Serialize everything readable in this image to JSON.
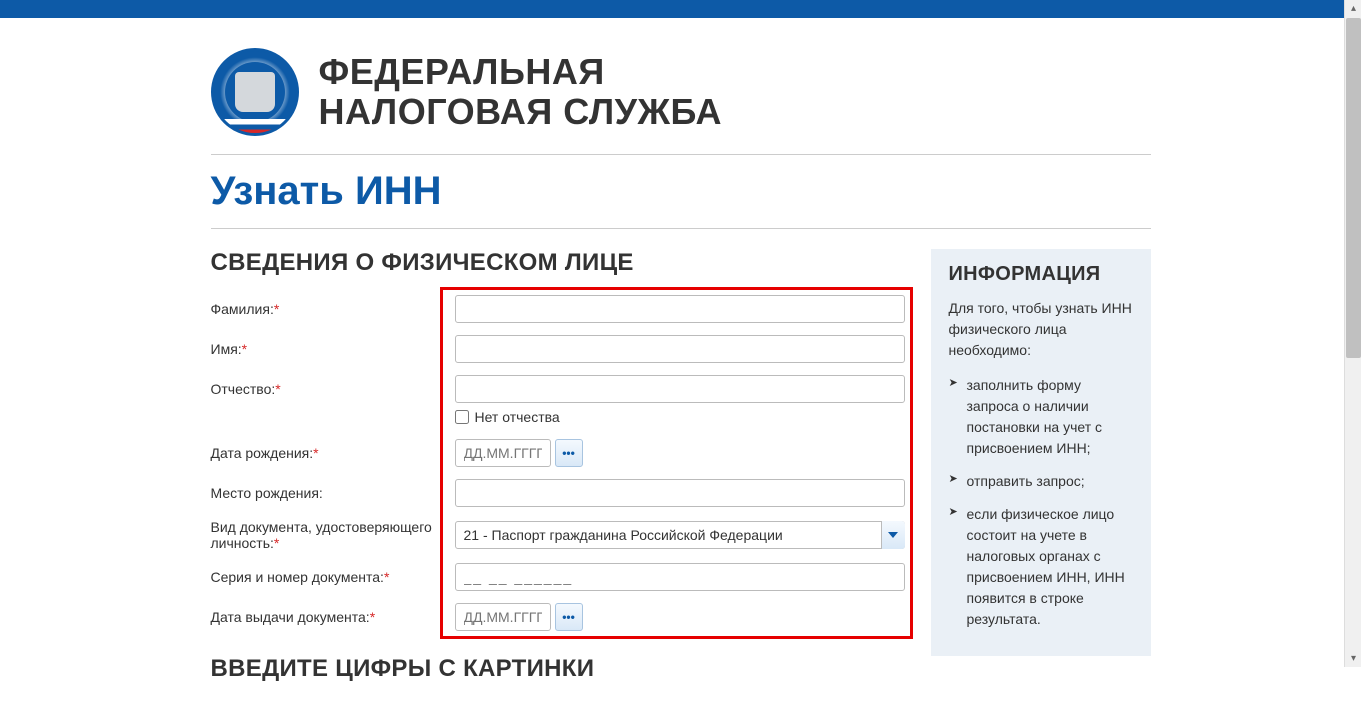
{
  "header": {
    "org_line1": "ФЕДЕРАЛЬНАЯ",
    "org_line2": "НАЛОГОВАЯ СЛУЖБА"
  },
  "page_title": "Узнать ИНН",
  "form": {
    "section_title": "СВЕДЕНИЯ О ФИЗИЧЕСКОМ ЛИЦЕ",
    "lastname_label": "Фамилия:",
    "firstname_label": "Имя:",
    "patronymic_label": "Отчество:",
    "no_patronymic_label": "Нет отчества",
    "dob_label": "Дата рождения:",
    "pob_label": "Место рождения:",
    "doc_type_label": "Вид документа, удостоверяющего личность:",
    "doc_type_value": "21 - Паспорт гражданина Российской Федерации",
    "doc_number_label": "Серия и номер документа:",
    "doc_number_placeholder": "__ __ ______",
    "doc_date_label": "Дата выдачи документа:",
    "date_placeholder": "ДД.ММ.ГГГГ",
    "date_btn": "•••"
  },
  "captcha": {
    "section_title": "ВВЕДИТЕ ЦИФРЫ С КАРТИНКИ"
  },
  "info": {
    "title": "ИНФОРМАЦИЯ",
    "lead": "Для того, чтобы узнать ИНН физического лица необходимо:",
    "items": [
      "заполнить форму запроса о наличии постановки на учет с присвоением ИНН;",
      "отправить запрос;",
      "если физическое лицо состоит на учете в налоговых органах с присвоением ИНН, ИНН появится в строке результата."
    ]
  }
}
